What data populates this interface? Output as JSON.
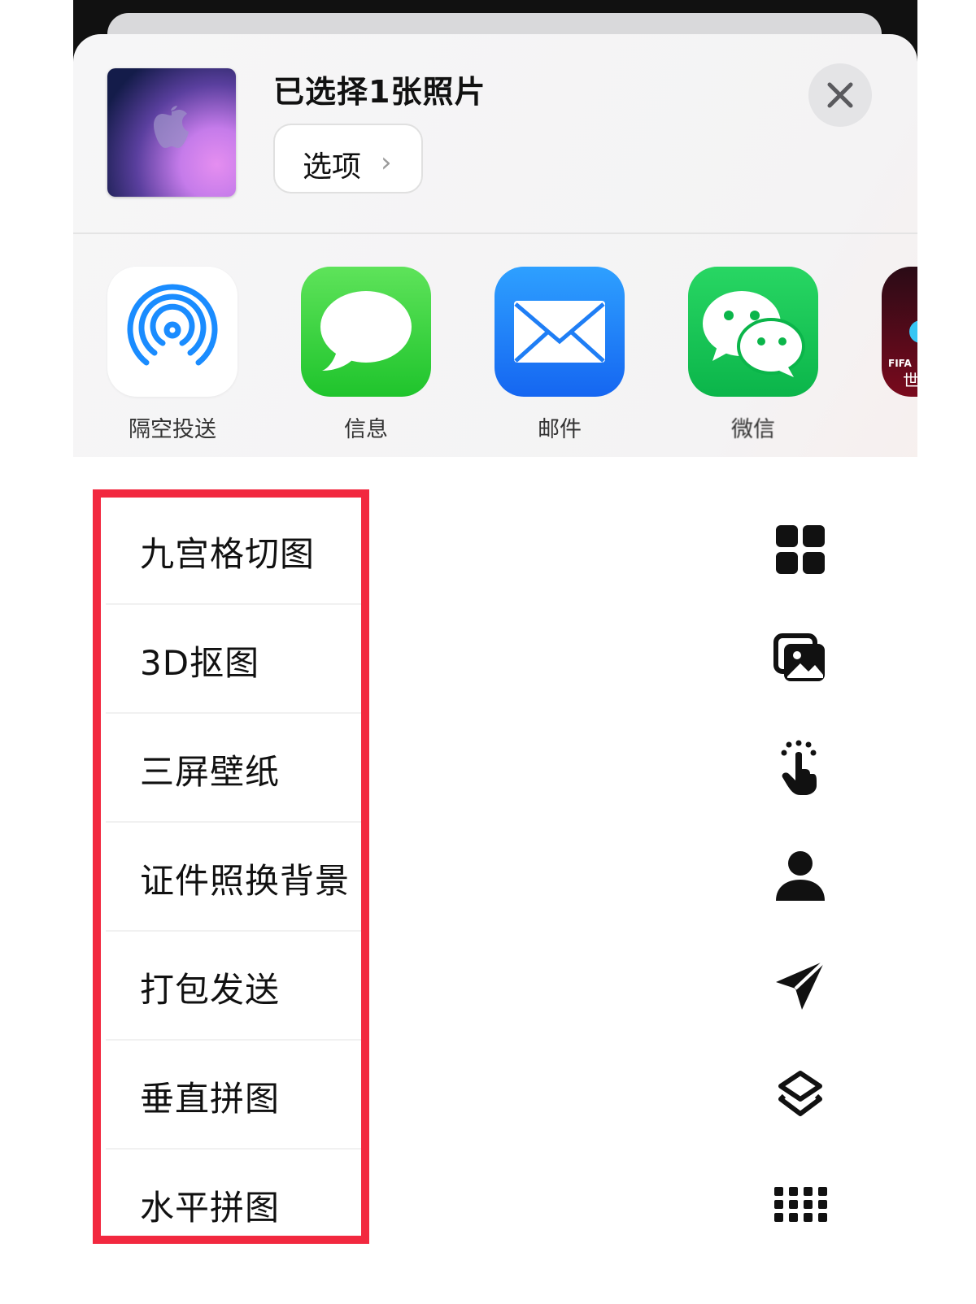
{
  "sheet": {
    "title": "已选择1张照片",
    "options_label": "选项",
    "options_chevron": "›"
  },
  "apps": [
    {
      "label": "隔空投送",
      "icon": "airdrop-icon"
    },
    {
      "label": "信息",
      "icon": "messages-icon"
    },
    {
      "label": "邮件",
      "icon": "mail-icon"
    },
    {
      "label": "微信",
      "icon": "wechat-icon"
    },
    {
      "label": "",
      "icon": "fifa-app-icon",
      "text_top": "FIFA",
      "text_bottom": "世"
    }
  ],
  "actions": [
    {
      "label": "九宫格切图",
      "icon": "grid-2x2-icon"
    },
    {
      "label": "3D抠图",
      "icon": "photo-stack-icon"
    },
    {
      "label": "三屏壁纸",
      "icon": "hand-tap-icon"
    },
    {
      "label": "证件照换背景",
      "icon": "person-icon"
    },
    {
      "label": "打包发送",
      "icon": "paper-plane-icon"
    },
    {
      "label": "垂直拼图",
      "icon": "layers-icon"
    },
    {
      "label": "水平拼图",
      "icon": "dots-grid-icon"
    }
  ],
  "colors": {
    "highlight": "#f2283f",
    "messages": "#1fc42c",
    "mail": "#1566f1",
    "wechat": "#0bb54a",
    "airdrop": "#1a8cff"
  }
}
